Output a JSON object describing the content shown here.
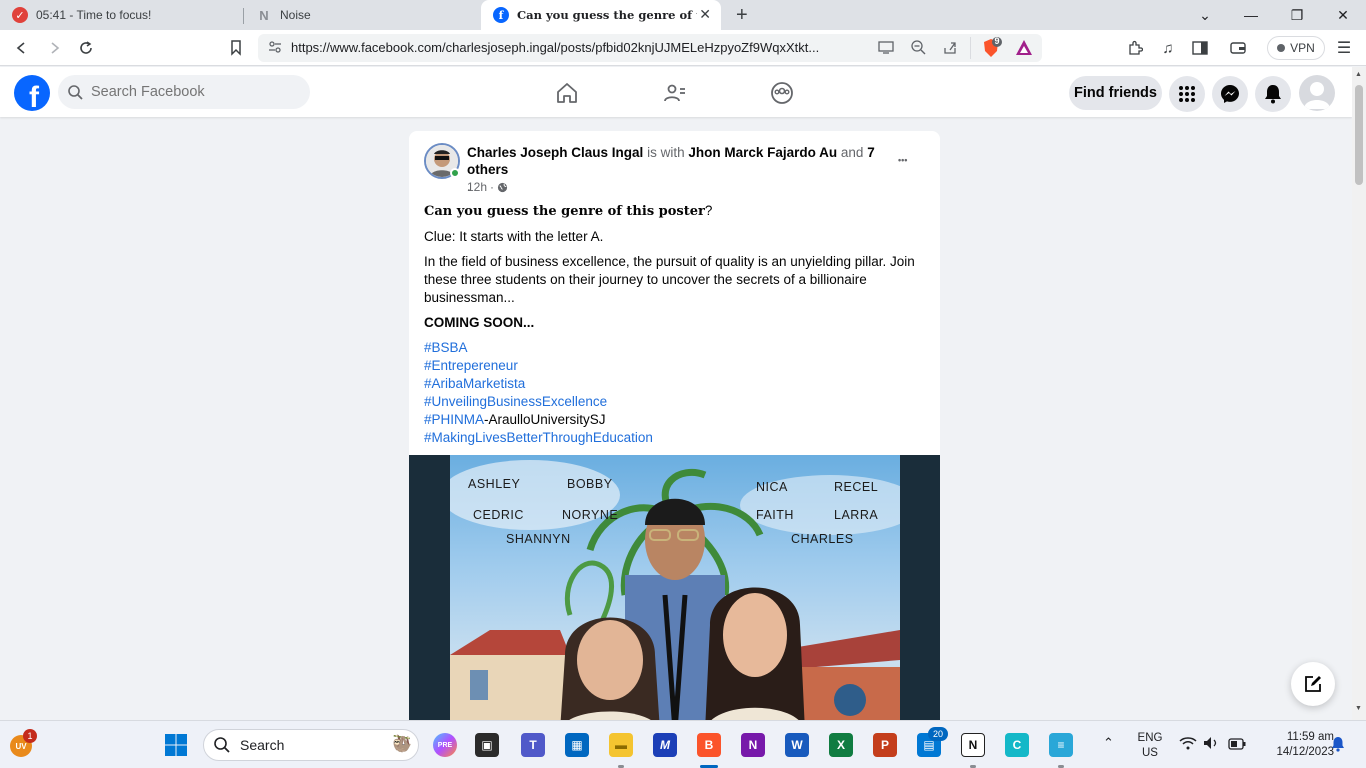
{
  "browser": {
    "tabs": [
      {
        "title": "05:41 - Time to focus!",
        "icon": "check-circle-icon",
        "icon_color": "#e0413b"
      },
      {
        "title": "Noise",
        "icon": "noise-icon"
      },
      {
        "title": "Can you guess the genre of this",
        "icon": "facebook-icon",
        "icon_color": "#0866ff",
        "active": true
      }
    ],
    "new_tab_label": "+",
    "url": "https://www.facebook.com/charlesjoseph.ingal/posts/pfbid02knjUJMELeHzpyoZf9WqxXtkt...",
    "vpn_label": "VPN",
    "brave_badge": "9"
  },
  "facebook": {
    "logo_letter": "f",
    "search_placeholder": "Search Facebook",
    "find_friends_label": "Find friends"
  },
  "post": {
    "author": "Charles Joseph Claus Ingal",
    "is_with": "is with",
    "with_person": "Jhon Marck Fajardo Au",
    "and": "and",
    "others": "7 others",
    "trailing": ".",
    "time": "12h",
    "time_sep": "·",
    "more": "•••",
    "question_bold": "Can you guess the genre of this poster",
    "question_mark": "?",
    "clue": "Clue: It starts with the letter A.",
    "description": "In the field of business excellence, the pursuit of quality is an unyielding pillar. Join these three students on their journey to uncover the secrets of a billionaire businessman...",
    "coming_soon": "COMING SOON...",
    "hashtags": [
      "#BSBA",
      "#Entrepereneur",
      "#AribaMarketista",
      "#UnveilingBusinessExcellence"
    ],
    "phinma_tag": "#PHINMA",
    "phinma_rest": "-AraulloUniversitySJ",
    "last_tag": "#MakingLivesBetterThroughEducation",
    "poster_names": {
      "ashley": "ASHLEY",
      "bobby": "BOBBY",
      "nica": "NICA",
      "recel": "RECEL",
      "cedric": "CEDRIC",
      "noryne": "NORYNE",
      "faith": "FAITH",
      "larra": "LARRA",
      "shannyn": "SHANNYN",
      "charles": "CHARLES"
    }
  },
  "taskbar": {
    "uv_badge": "1",
    "uv_label": "UV",
    "search_label": "Search",
    "notif_count": "20",
    "lang_top": "ENG",
    "lang_bottom": "US",
    "time": "11:59 am",
    "date": "14/12/2023"
  },
  "colors": {
    "facebook_blue": "#0866ff",
    "link_blue": "#216fdb",
    "page_bg": "#f0f2f5"
  }
}
